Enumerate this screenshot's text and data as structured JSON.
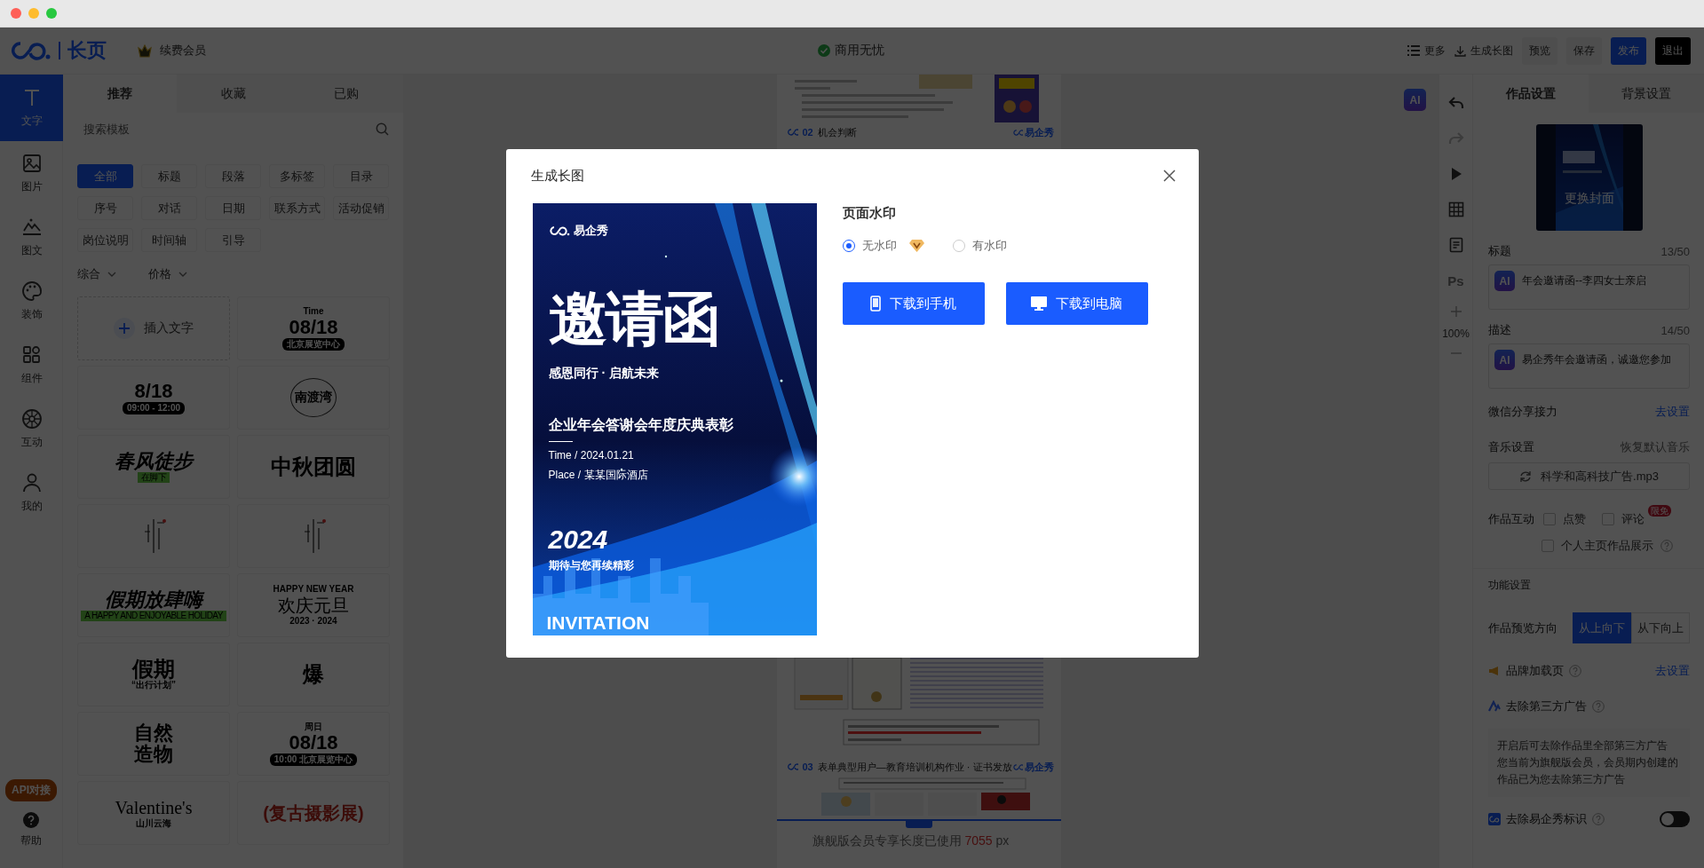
{
  "topbar": {
    "brand": "长页",
    "member": "续费会员",
    "status": "商用无忧",
    "actions": [
      {
        "label": "更多",
        "kind": "menu"
      },
      {
        "label": "生成长图",
        "kind": "download"
      },
      {
        "label": "预览",
        "kind": "plain"
      },
      {
        "label": "保存",
        "kind": "plain"
      },
      {
        "label": "发布",
        "kind": "primary"
      },
      {
        "label": "退出",
        "kind": "dark"
      }
    ]
  },
  "sidebar": {
    "items": [
      {
        "label": "文字",
        "selected": true
      },
      {
        "label": "图片",
        "selected": false
      },
      {
        "label": "图文",
        "selected": false
      },
      {
        "label": "装饰",
        "selected": false
      },
      {
        "label": "组件",
        "selected": false
      },
      {
        "label": "互动",
        "selected": false
      },
      {
        "label": "我的",
        "selected": false
      }
    ],
    "api_badge": "API对接",
    "help": "帮助"
  },
  "template_panel": {
    "tabs": [
      {
        "label": "推荐",
        "selected": true
      },
      {
        "label": "收藏",
        "selected": false
      },
      {
        "label": "已购",
        "selected": false
      }
    ],
    "search": {
      "placeholder": "搜索模板"
    },
    "categories": [
      {
        "label": "全部",
        "selected": true
      },
      {
        "label": "标题",
        "selected": false
      },
      {
        "label": "段落",
        "selected": false
      },
      {
        "label": "多标签",
        "selected": false
      },
      {
        "label": "目录",
        "selected": false
      },
      {
        "label": "序号",
        "selected": false
      },
      {
        "label": "对话",
        "selected": false
      },
      {
        "label": "日期",
        "selected": false
      },
      {
        "label": "联系方式",
        "selected": false
      },
      {
        "label": "活动促销",
        "selected": false
      },
      {
        "label": "岗位说明",
        "selected": false
      },
      {
        "label": "时间轴",
        "selected": false
      },
      {
        "label": "引导",
        "selected": false
      }
    ],
    "sorts": [
      "综合",
      "价格"
    ],
    "insert_label": "插入文字",
    "templates": [
      {
        "kind": "date",
        "top": "Time",
        "main": "08/18",
        "sub": "北京展览中心"
      },
      {
        "kind": "date",
        "main": "8/18",
        "sub": "09:00 - 12:00"
      },
      {
        "kind": "seal",
        "main": "南渡湾"
      },
      {
        "kind": "green",
        "main": "春风徒步",
        "sub": "在脚下"
      },
      {
        "kind": "brush",
        "main": "中秋团圆"
      },
      {
        "kind": "mark"
      },
      {
        "kind": "mark"
      },
      {
        "kind": "green",
        "main": "假期放肆嗨",
        "sub": "A HAPPY AND ENJOYABLE HOLIDAY"
      },
      {
        "kind": "serif",
        "top": "HAPPY NEW YEAR",
        "main": "欢庆元旦",
        "sub": "2023 · 2024"
      },
      {
        "kind": "brush",
        "main": "假期",
        "sub": "“出行计划”"
      },
      {
        "kind": "brush",
        "main": "爆"
      },
      {
        "kind": "stack",
        "main": "自然造物"
      },
      {
        "kind": "date",
        "top": "周日",
        "main": "08/18",
        "sub": "10:00 北京展览中心"
      },
      {
        "kind": "serif",
        "main": "Valentine's",
        "sub": "山川云海"
      },
      {
        "kind": "red",
        "main": "(复古摄影展)"
      }
    ]
  },
  "canvas": {
    "ai_badge": "AI",
    "sections": [
      {
        "number": "02",
        "title": "机会判断",
        "brand": "易企秀"
      },
      {
        "number": "03",
        "title": "表单典型用户—教育培训机构作业 · 证书发放",
        "brand": "易企秀"
      }
    ],
    "length_label": "旗舰版会员专享长度已使用",
    "length_value": "7055",
    "length_unit": "px"
  },
  "tools": {
    "items": [
      {
        "kind": "undo",
        "disabled": false
      },
      {
        "kind": "redo",
        "disabled": true
      },
      {
        "kind": "play",
        "disabled": false
      },
      {
        "kind": "grid",
        "disabled": false
      },
      {
        "kind": "doc",
        "disabled": false
      },
      {
        "kind": "ps",
        "label": "Ps",
        "disabled": true
      }
    ],
    "zoom": "100%"
  },
  "settings": {
    "tabs": [
      {
        "label": "作品设置",
        "selected": true
      },
      {
        "label": "背景设置",
        "selected": false
      }
    ],
    "cover_label": "更换封面",
    "title_field": {
      "label": "标题",
      "count": "13/50",
      "ai": "AI",
      "value": "年会邀请函--李四女士亲启"
    },
    "description_field": {
      "label": "描述",
      "count": "14/50",
      "ai": "AI",
      "value": "易企秀年会邀请函，诚邀您参加"
    },
    "wechat": {
      "label": "微信分享接力",
      "link": "去设置"
    },
    "music": {
      "label": "音乐设置",
      "reset": "恢复默认音乐",
      "file": "科学和高科技广告.mp3"
    },
    "interaction": {
      "label": "作品互动",
      "options": [
        {
          "label": "点赞",
          "checked": false
        },
        {
          "label": "评论",
          "checked": false,
          "badge": "限免"
        },
        {
          "label": "个人主页作品展示",
          "checked": false
        }
      ]
    },
    "function_heading": "功能设置",
    "direction": {
      "label": "作品预览方向",
      "options": [
        {
          "label": "从上向下",
          "selected": true
        },
        {
          "label": "从下向上",
          "selected": false
        }
      ]
    },
    "brand_page": {
      "label": "品牌加载页",
      "link": "去设置"
    },
    "remove_ads": {
      "label": "去除第三方广告",
      "note": [
        "开启后可去除作品里全部第三方广告",
        "您当前为旗舰版会员，会员期内创建的作品已为您去除第三方广告"
      ]
    },
    "remove_logo": {
      "label": "去除易企秀标识",
      "on": false
    }
  },
  "modal": {
    "title": "生成长图",
    "poster": {
      "logo": "易企秀",
      "title": "邀请函",
      "tagline": "感恩同行 · 启航未来",
      "event": "企业年会答谢会年度庆典表彰",
      "time": "Time / 2024.01.21",
      "place": "Place / 某某国际酒店",
      "year": "2024",
      "wish": "期待与您再续精彩",
      "footer": "INVITATION"
    },
    "watermark": {
      "label": "页面水印",
      "options": [
        {
          "label": "无水印",
          "selected": true,
          "vip": true
        },
        {
          "label": "有水印",
          "selected": false,
          "vip": false
        }
      ]
    },
    "buttons": [
      {
        "label": "下载到手机",
        "kind": "phone"
      },
      {
        "label": "下载到电脑",
        "kind": "computer"
      }
    ]
  }
}
